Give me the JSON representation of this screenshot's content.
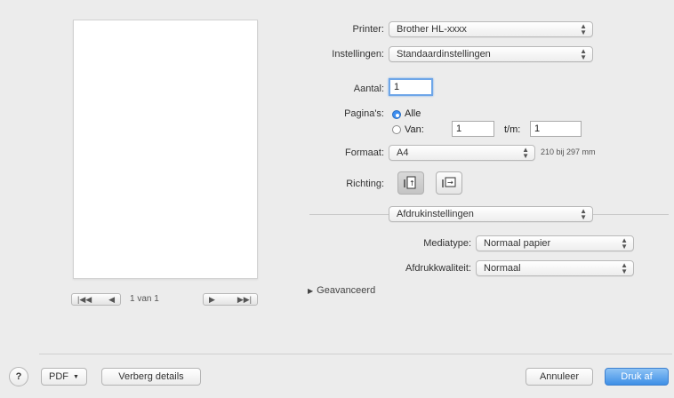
{
  "preview": {
    "first_label": "|◀◀",
    "prev_label": "◀",
    "page_label": "1 van 1",
    "next_label": "▶",
    "last_label": "▶▶|"
  },
  "printer": {
    "label": "Printer:",
    "value": "Brother HL-xxxx"
  },
  "presets": {
    "label": "Instellingen:",
    "value": "Standaardinstellingen"
  },
  "copies": {
    "label": "Aantal:",
    "value": "1"
  },
  "pages": {
    "label": "Pagina's:",
    "all_label": "Alle",
    "from_label": "Van:",
    "from_value": "1",
    "to_label": "t/m:",
    "to_value": "1",
    "selected": "all"
  },
  "paper": {
    "label": "Formaat:",
    "value": "A4",
    "dimensions": "210 bij 297 mm"
  },
  "orientation": {
    "label": "Richting:",
    "selected": "portrait"
  },
  "section": {
    "value": "Afdrukinstellingen"
  },
  "media_type": {
    "label": "Mediatype:",
    "value": "Normaal papier"
  },
  "quality": {
    "label": "Afdrukkwaliteit:",
    "value": "Normaal"
  },
  "advanced": {
    "label": "Geavanceerd"
  },
  "footer": {
    "help_label": "?",
    "pdf_label": "PDF",
    "hide_details_label": "Verberg details",
    "cancel_label": "Annuleer",
    "print_label": "Druk af"
  },
  "colors": {
    "accent": "#3e8fe6",
    "background": "#ececec"
  }
}
